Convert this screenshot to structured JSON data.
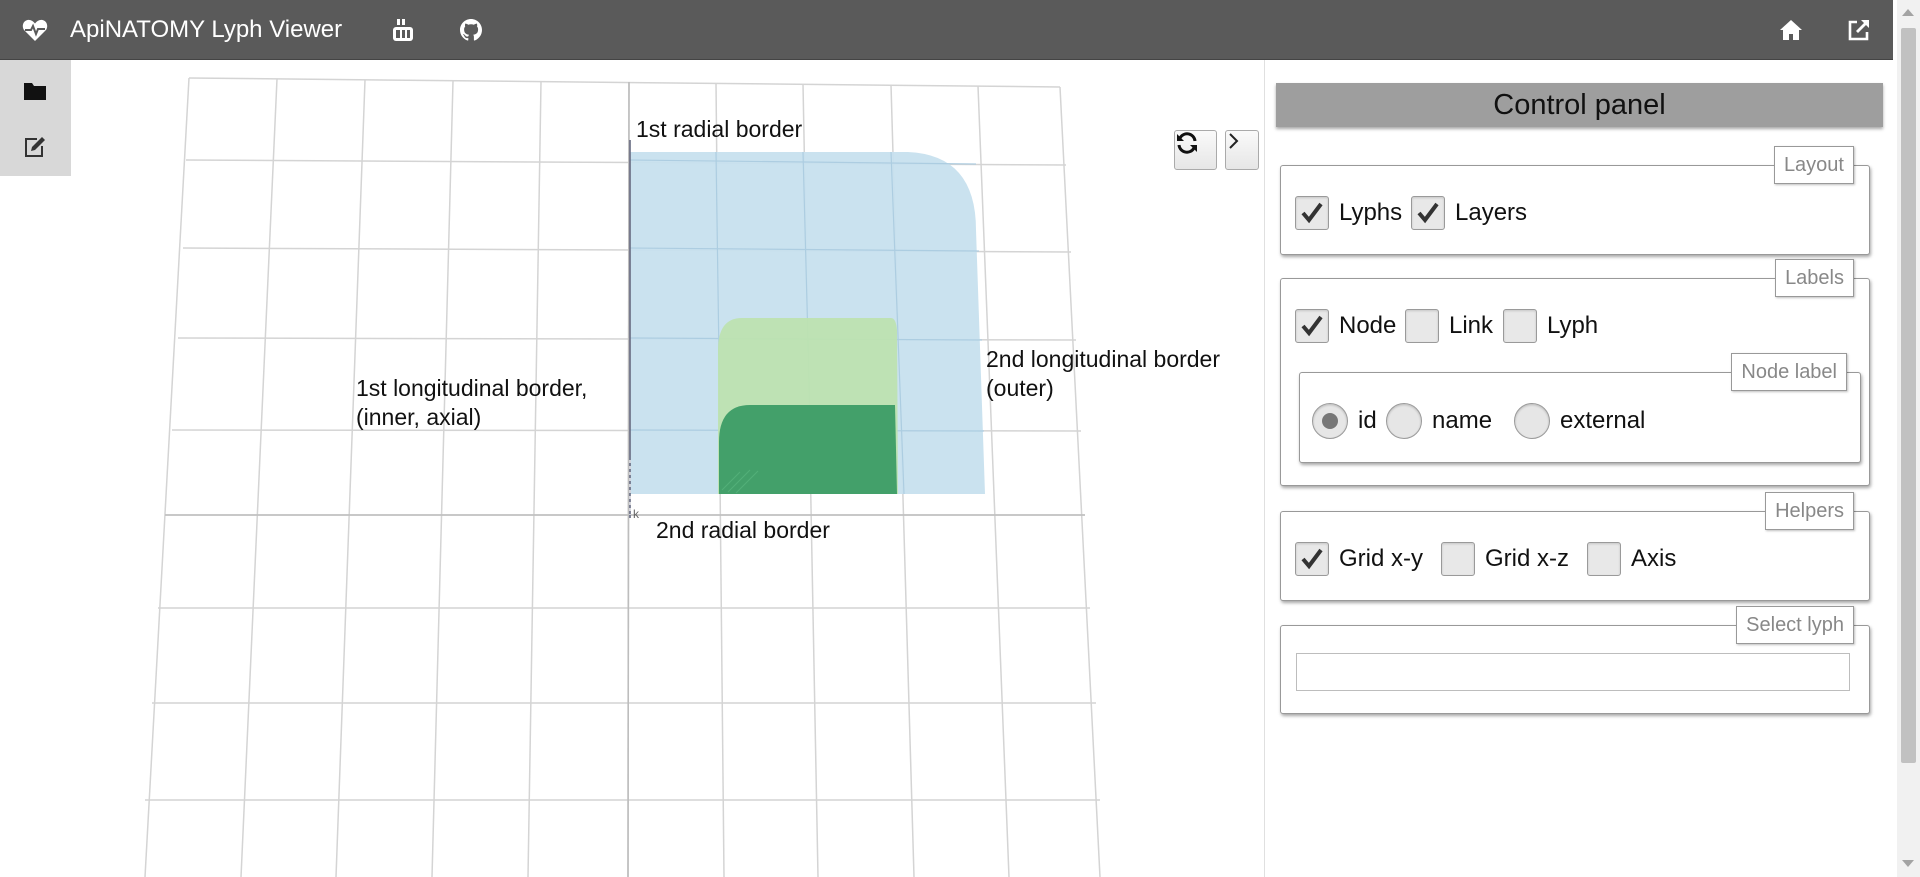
{
  "app": {
    "title": "ApiNATOMY Lyph Viewer"
  },
  "toolbar": {
    "icons": [
      "heartbeat-icon",
      "youtube-icon",
      "github-icon",
      "home-icon",
      "external-link-icon"
    ]
  },
  "sidebar": {
    "icons": [
      "folder-icon",
      "edit-icon"
    ]
  },
  "viewport": {
    "labels": {
      "radial1": "1st radial border",
      "radial2": "2nd radial border",
      "long1_line1": "1st longitudinal border,",
      "long1_line2": "(inner, axial)",
      "long2_line1": "2nd longitudinal border",
      "long2_line2": "(outer)"
    },
    "buttons": {
      "refresh_icon": "refresh-icon",
      "toggle_icon": "chevron-right-icon"
    },
    "colors": {
      "lyph": "#c7e0ee",
      "layer_light": "#bde2b0",
      "layer_dark": "#43a06a",
      "grid": "#d4d4d4"
    }
  },
  "panel": {
    "header": "Control panel",
    "layout": {
      "legend": "Layout",
      "items": [
        {
          "label": "Lyphs",
          "checked": true
        },
        {
          "label": "Layers",
          "checked": true
        }
      ]
    },
    "labels": {
      "legend": "Labels",
      "items": [
        {
          "label": "Node",
          "checked": true
        },
        {
          "label": "Link",
          "checked": false
        },
        {
          "label": "Lyph",
          "checked": false
        }
      ],
      "node_label": {
        "legend": "Node label",
        "options": [
          {
            "label": "id",
            "selected": true
          },
          {
            "label": "name",
            "selected": false
          },
          {
            "label": "external",
            "selected": false
          }
        ]
      }
    },
    "helpers": {
      "legend": "Helpers",
      "items": [
        {
          "label": "Grid x-y",
          "checked": true
        },
        {
          "label": "Grid x-z",
          "checked": false
        },
        {
          "label": "Axis",
          "checked": false
        }
      ]
    },
    "select_lyph": {
      "legend": "Select lyph",
      "value": ""
    }
  }
}
